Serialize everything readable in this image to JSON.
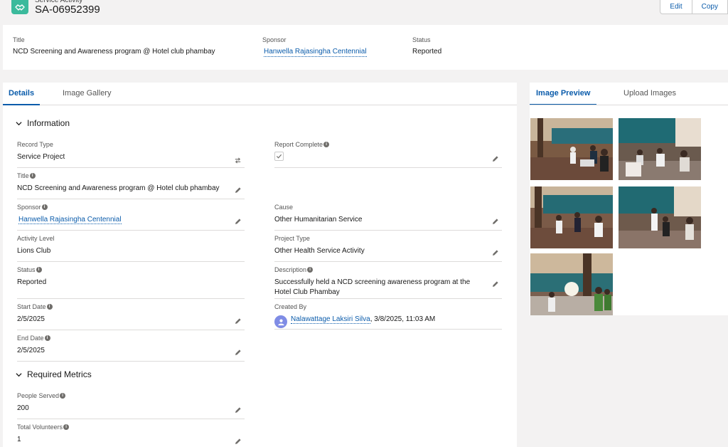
{
  "header": {
    "object_type": "Service Activity",
    "record_name": "SA-06952399",
    "buttons": {
      "edit": "Edit",
      "copy": "Copy"
    }
  },
  "highlights": {
    "title_label": "Title",
    "title_value": "NCD Screening and Awareness program @ Hotel club phambay",
    "sponsor_label": "Sponsor",
    "sponsor_value": "Hanwella Rajasingha Centennial",
    "status_label": "Status",
    "status_value": "Reported"
  },
  "tabs": {
    "details": "Details",
    "gallery": "Image Gallery"
  },
  "sections": {
    "information": "Information",
    "metrics": "Required Metrics"
  },
  "fields": {
    "record_type": {
      "label": "Record Type",
      "value": "Service Project"
    },
    "report_complete": {
      "label": "Report Complete",
      "checked": true
    },
    "title": {
      "label": "Title",
      "value": "NCD Screening and Awareness program @ Hotel club phambay"
    },
    "sponsor": {
      "label": "Sponsor",
      "value": "Hanwella Rajasingha Centennial"
    },
    "cause": {
      "label": "Cause",
      "value": "Other Humanitarian Service"
    },
    "activity_level": {
      "label": "Activity Level",
      "value": "Lions Club"
    },
    "project_type": {
      "label": "Project Type",
      "value": "Other Health Service Activity"
    },
    "status": {
      "label": "Status",
      "value": "Reported"
    },
    "description": {
      "label": "Description",
      "value": "Successfully held a NCD screening awareness program at the Hotel Club Phambay"
    },
    "start_date": {
      "label": "Start Date",
      "value": "2/5/2025"
    },
    "created_by": {
      "label": "Created By",
      "user": "Nalawattage Laksiri Silva",
      "timestamp": ", 3/8/2025, 11:03 AM"
    },
    "end_date": {
      "label": "End Date",
      "value": "2/5/2025"
    },
    "people_served": {
      "label": "People Served",
      "value": "200"
    },
    "total_volunteers": {
      "label": "Total Volunteers",
      "value": "1"
    }
  },
  "right_tabs": {
    "preview": "Image Preview",
    "upload": "Upload Images"
  },
  "icons": {
    "app": "handshake-icon",
    "info": "info-icon",
    "edit": "pencil-icon",
    "record_type": "change-record-type-icon",
    "chevron": "chevron-down-icon",
    "user": "user-avatar-icon",
    "check": "check-icon"
  },
  "colors": {
    "brand": "#0b5cab",
    "app_icon": "#3bba9c",
    "avatar": "#7f8ce5"
  }
}
